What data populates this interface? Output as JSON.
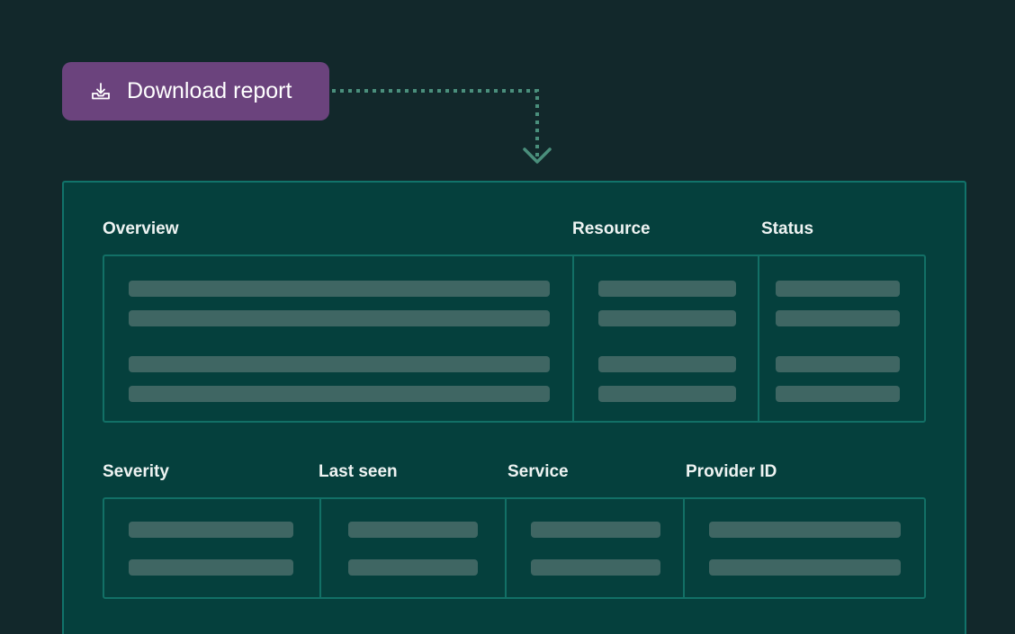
{
  "download_button": {
    "label": "Download report",
    "icon": "download-tray-icon"
  },
  "report": {
    "top_table": {
      "columns": [
        "Overview",
        "Resource",
        "Status"
      ]
    },
    "bottom_table": {
      "columns": [
        "Severity",
        "Last seen",
        "Service",
        "Provider ID"
      ]
    }
  },
  "colors": {
    "background": "#12282b",
    "button": "#6b437d",
    "panel": "#05403d",
    "border": "#11736a",
    "placeholder_bar": "#3f6663",
    "connector": "#4a8f7c"
  }
}
